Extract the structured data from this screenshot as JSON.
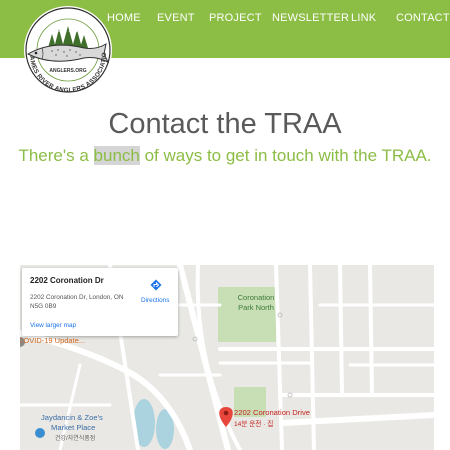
{
  "nav": {
    "items": [
      "HOME",
      "EVENT",
      "PROJECT",
      "NEWSLETTER",
      "LINK",
      "CONTACT"
    ]
  },
  "logo": {
    "established": "EST. 1986",
    "website": "ANGLERS.ORG",
    "org_name": "THAMES RIVER ANGLERS ASSOCIATION"
  },
  "page": {
    "title": "Contact the TRAA",
    "subtitle_before": "There's a ",
    "subtitle_highlight": "bunch",
    "subtitle_after": " of ways to get in touch with the TRAA."
  },
  "map": {
    "card": {
      "title": "2202 Coronation Dr",
      "address": "2202 Coronation Dr, London, ON N5G 0B9",
      "directions_label": "Directions",
      "larger_map_link": "View larger map"
    },
    "labels": {
      "park": "Coronation Park North",
      "marker_title": "2202 Coronation Drive",
      "marker_subtitle": "14분 운전 · 집",
      "market_line1": "Jaydancin & Zoe's",
      "market_line2": "Market Place",
      "market_line3": "건강/자연식품점",
      "covid": "COVID-19 Update..."
    },
    "colors": {
      "park": "#c8dfb5",
      "marker": "#e8453c",
      "water": "#aad3df"
    }
  },
  "colors": {
    "brand_green": "#8cbd45",
    "title_gray": "#5a5a5a"
  }
}
